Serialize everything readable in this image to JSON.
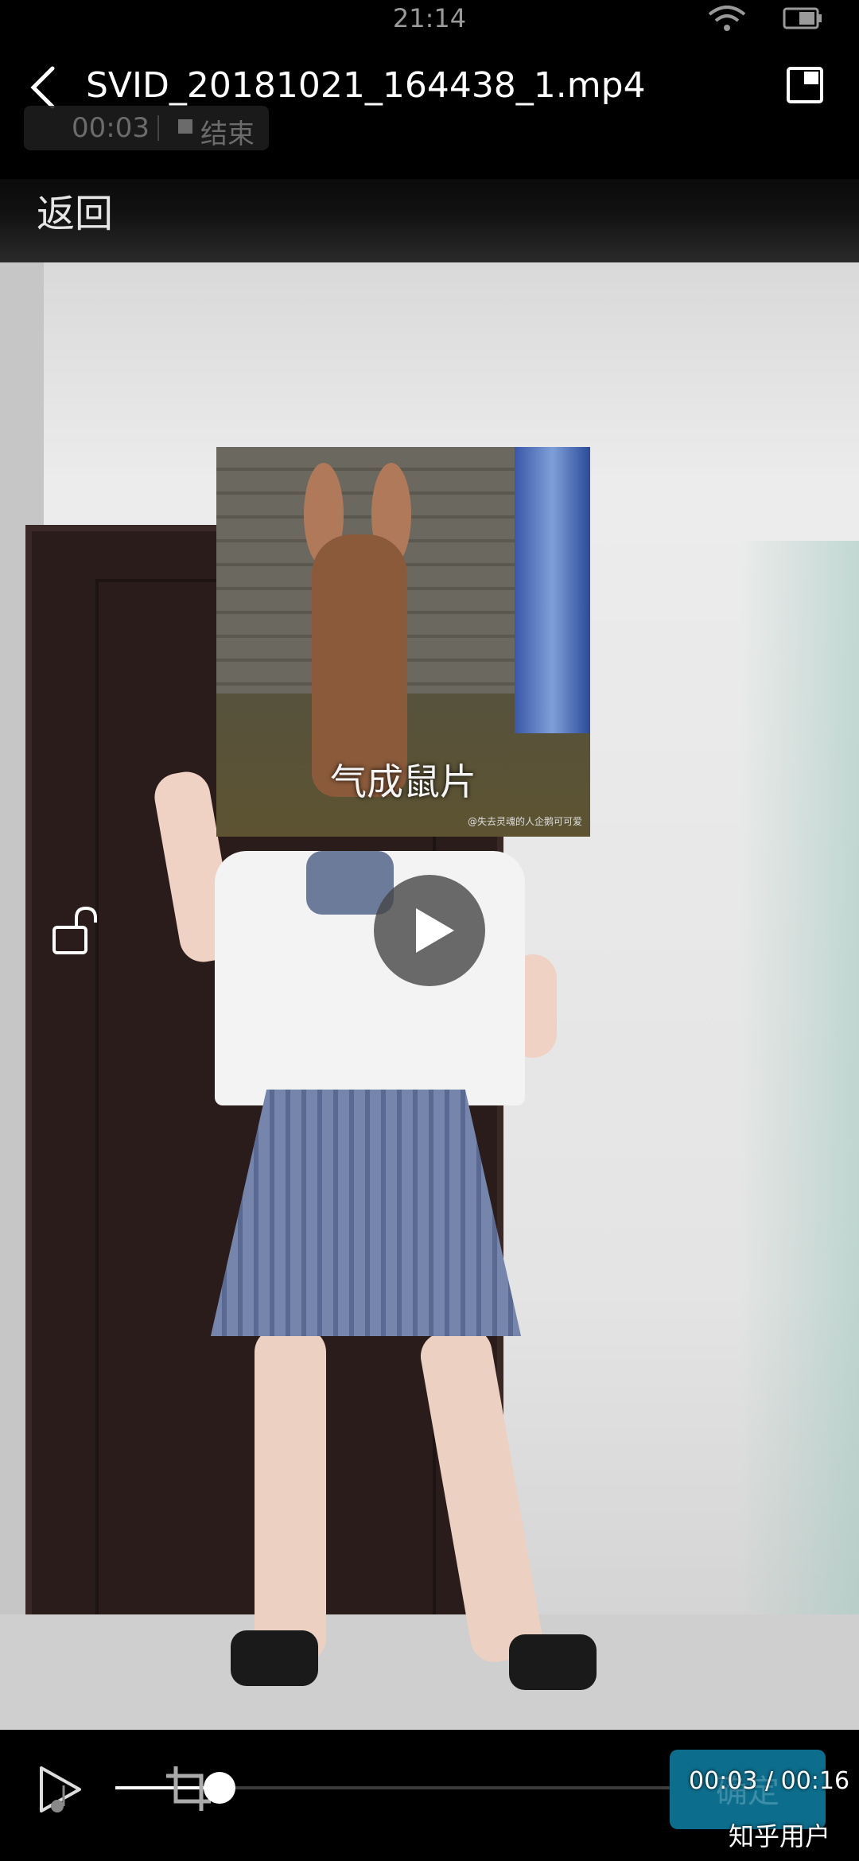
{
  "status_bar": {
    "time": "21:14"
  },
  "header": {
    "title": "SVID_20181021_164438_1.mp4",
    "recording_time": "00:03",
    "recording_end_label": "结束",
    "back_label": "返回"
  },
  "video": {
    "sticker_caption": "气成鼠片",
    "sticker_credit": "@失去灵魂的人企鹅可可爱"
  },
  "controls": {
    "confirm_label": "确定",
    "time_display": "00:03 / 00:16",
    "progress_fraction": 0.1875
  },
  "watermark": "知乎用户"
}
